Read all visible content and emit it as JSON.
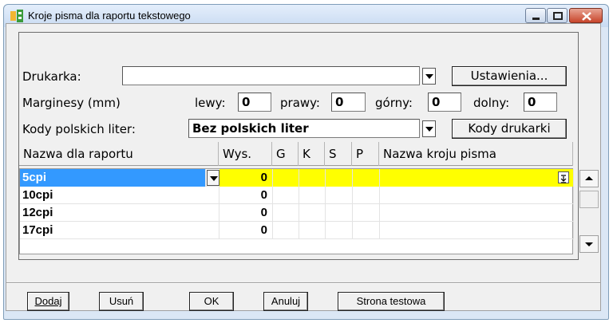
{
  "window": {
    "title": "Kroje pisma dla raportu tekstowego"
  },
  "form": {
    "printer_label": "Drukarka:",
    "printer_value": "",
    "settings_button": "Ustawienia...",
    "margins_label": "Marginesy (mm)",
    "left_label": "lewy:",
    "left_value": "0",
    "right_label": "prawy:",
    "right_value": "0",
    "top_label": "górny:",
    "top_value": "0",
    "bottom_label": "dolny:",
    "bottom_value": "0",
    "codes_label": "Kody polskich liter:",
    "codes_value": "Bez polskich liter",
    "printer_codes_button": "Kody drukarki"
  },
  "grid": {
    "headers": [
      "Nazwa dla raportu",
      "Wys.",
      "G",
      "K",
      "S",
      "P",
      "Nazwa kroju pisma"
    ],
    "rows": [
      {
        "name": "5cpi",
        "height": "0"
      },
      {
        "name": "10cpi",
        "height": "0"
      },
      {
        "name": "12cpi",
        "height": "0"
      },
      {
        "name": "17cpi",
        "height": "0"
      }
    ]
  },
  "buttons": {
    "add": "Dodaj",
    "remove": "Usuń",
    "ok": "OK",
    "cancel": "Anuluj",
    "test_page": "Strona testowa"
  },
  "colors": {
    "selection_blue": "#3399ff",
    "highlight_yellow": "#ffff00",
    "close_red": "#c8452b"
  }
}
